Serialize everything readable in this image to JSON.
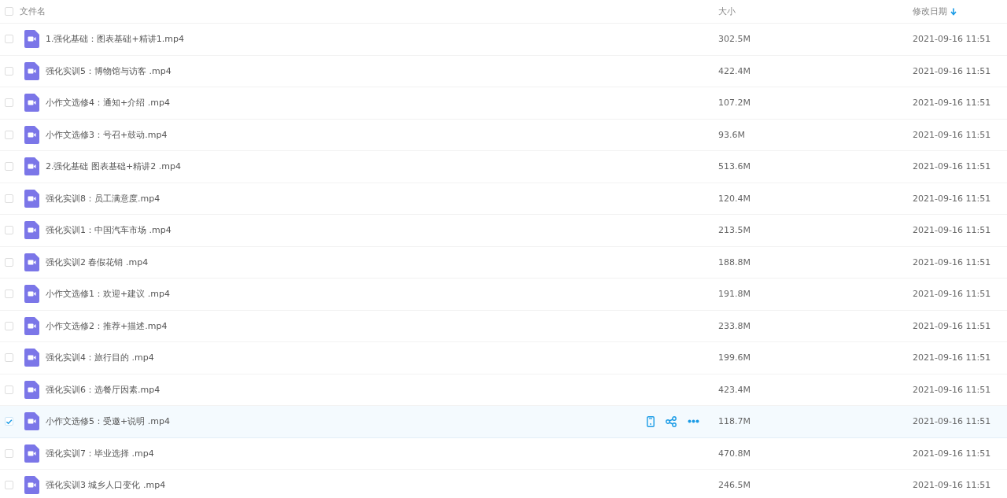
{
  "header": {
    "checked": false,
    "columns": [
      {
        "label": "文件名",
        "sorted": false
      },
      {
        "label": "大小",
        "sorted": false
      },
      {
        "label": "修改日期",
        "sorted": true
      }
    ]
  },
  "rows": [
    {
      "name": "1.强化基础：图表基础+精讲1.mp4",
      "size": "302.5M",
      "date": "2021-09-16 11:51",
      "selected": false
    },
    {
      "name": "强化实训5：博物馆与访客 .mp4",
      "size": "422.4M",
      "date": "2021-09-16 11:51",
      "selected": false
    },
    {
      "name": "小作文选修4：通知+介绍 .mp4",
      "size": "107.2M",
      "date": "2021-09-16 11:51",
      "selected": false
    },
    {
      "name": "小作文选修3：号召+鼓动.mp4",
      "size": "93.6M",
      "date": "2021-09-16 11:51",
      "selected": false
    },
    {
      "name": "2.强化基础 图表基础+精讲2 .mp4",
      "size": "513.6M",
      "date": "2021-09-16 11:51",
      "selected": false
    },
    {
      "name": "强化实训8：员工满意度.mp4",
      "size": "120.4M",
      "date": "2021-09-16 11:51",
      "selected": false
    },
    {
      "name": "强化实训1：中国汽车市场 .mp4",
      "size": "213.5M",
      "date": "2021-09-16 11:51",
      "selected": false
    },
    {
      "name": "强化实训2 春假花销 .mp4",
      "size": "188.8M",
      "date": "2021-09-16 11:51",
      "selected": false
    },
    {
      "name": "小作文选修1：欢迎+建议 .mp4",
      "size": "191.8M",
      "date": "2021-09-16 11:51",
      "selected": false
    },
    {
      "name": "小作文选修2：推荐+描述.mp4",
      "size": "233.8M",
      "date": "2021-09-16 11:51",
      "selected": false
    },
    {
      "name": "强化实训4：旅行目的 .mp4",
      "size": "199.6M",
      "date": "2021-09-16 11:51",
      "selected": false
    },
    {
      "name": "强化实训6：选餐厅因素.mp4",
      "size": "423.4M",
      "date": "2021-09-16 11:51",
      "selected": false
    },
    {
      "name": "小作文选修5：受邀+说明 .mp4",
      "size": "118.7M",
      "date": "2021-09-16 11:51",
      "selected": true
    },
    {
      "name": "强化实训7：毕业选择 .mp4",
      "size": "470.8M",
      "date": "2021-09-16 11:51",
      "selected": false
    },
    {
      "name": "强化实训3 城乡人口变化 .mp4",
      "size": "246.5M",
      "date": "2021-09-16 11:51",
      "selected": false
    }
  ]
}
